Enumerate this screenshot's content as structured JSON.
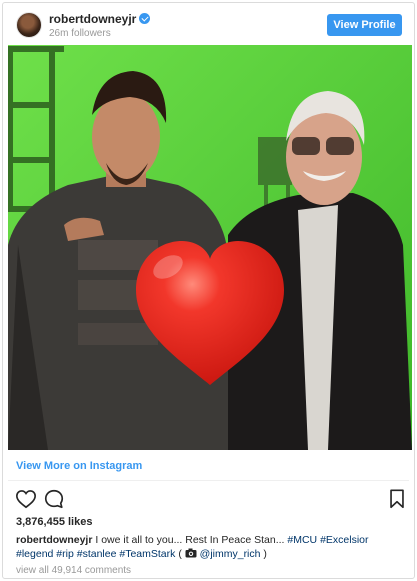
{
  "post": {
    "username": "robertdowneyjr",
    "followers": "26m followers",
    "view_profile_label": "View Profile",
    "view_more_label": "View More on Instagram",
    "likes": "3,876,455 likes",
    "caption_user": "robertdowneyjr",
    "caption_text": "I owe it all to you... Rest In Peace Stan...",
    "caption_hashtags": [
      "#MCU",
      "#Excelsior",
      "#legend",
      "#rip",
      "#stanlee",
      "#TeamStark"
    ],
    "caption_credit_open": "(",
    "caption_credit_handle": "@jimmy_rich",
    "caption_credit_close": ")",
    "comments_link": "view all 49,914 comments",
    "accent_color": "#3897f0",
    "verified": true
  },
  "icons": {
    "verified": "verified-badge-icon",
    "like": "heart-outline-icon",
    "comment": "comment-bubble-icon",
    "bookmark": "bookmark-icon",
    "camera": "camera-icon",
    "photo_overlay": "red-heart-emoji"
  }
}
